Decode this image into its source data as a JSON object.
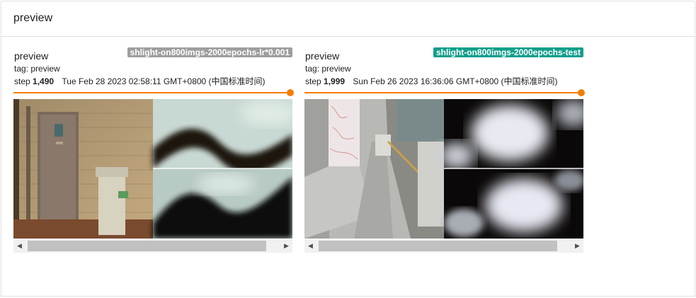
{
  "header": {
    "title": "preview"
  },
  "cards": [
    {
      "run": "shlight-on800imgs-2000epochs-lr*0.001",
      "run_color": "#9e9e9e",
      "title": "preview",
      "tag": "tag: preview",
      "step_label": "step",
      "step": "1,490",
      "date": "Tue Feb 28 2023 02:58:11 GMT+0800 (中国标准时间)",
      "slider_value": 1.0
    },
    {
      "run": "shlight-on800imgs-2000epochs-test",
      "run_color": "#129f8c",
      "title": "preview",
      "tag": "tag: preview",
      "step_label": "step",
      "step": "1,999",
      "date": "Sun Feb 26 2023 16:36:06 GMT+0800 (中国标准时间)",
      "slider_value": 1.0
    }
  ],
  "scrollbar": {
    "left_arrow": "◀",
    "right_arrow": "▶"
  }
}
